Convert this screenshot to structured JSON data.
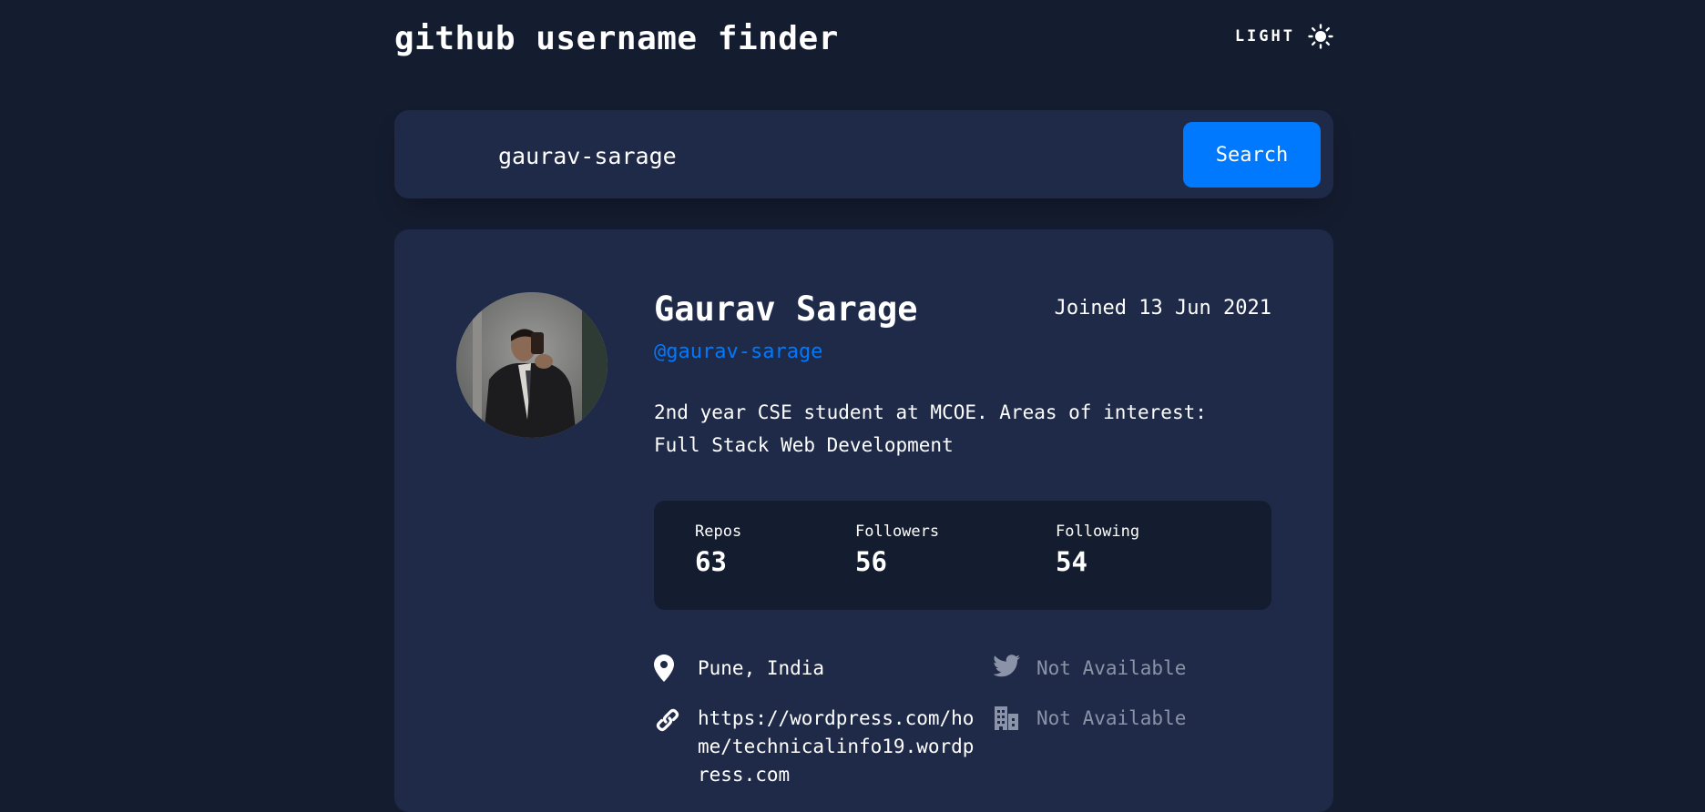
{
  "header": {
    "title": "github username finder",
    "theme_label": "LIGHT",
    "theme_icon": "sun-icon"
  },
  "search": {
    "value": "gaurav-sarage",
    "placeholder": "",
    "button_label": "Search"
  },
  "profile": {
    "name": "Gaurav Sarage",
    "login": "@gaurav-sarage",
    "joined": "Joined 13 Jun 2021",
    "bio": "2nd year CSE student at MCOE. Areas of interest: Full Stack Web Development",
    "avatar": "profile-avatar-photo"
  },
  "stats": {
    "repos_label": "Repos",
    "repos_value": "63",
    "followers_label": "Followers",
    "followers_value": "56",
    "following_label": "Following",
    "following_value": "54"
  },
  "links": {
    "location": "Pune, India",
    "website_lines": [
      "https://wordpress.com/ho",
      "me/technicalinfo19.wordp",
      "ress.com"
    ],
    "twitter": "Not Available",
    "company": "Not Available"
  },
  "colors": {
    "background": "#141c2f",
    "card": "#1f2a48",
    "accent": "#0079ff",
    "muted": "#8b93a8"
  }
}
